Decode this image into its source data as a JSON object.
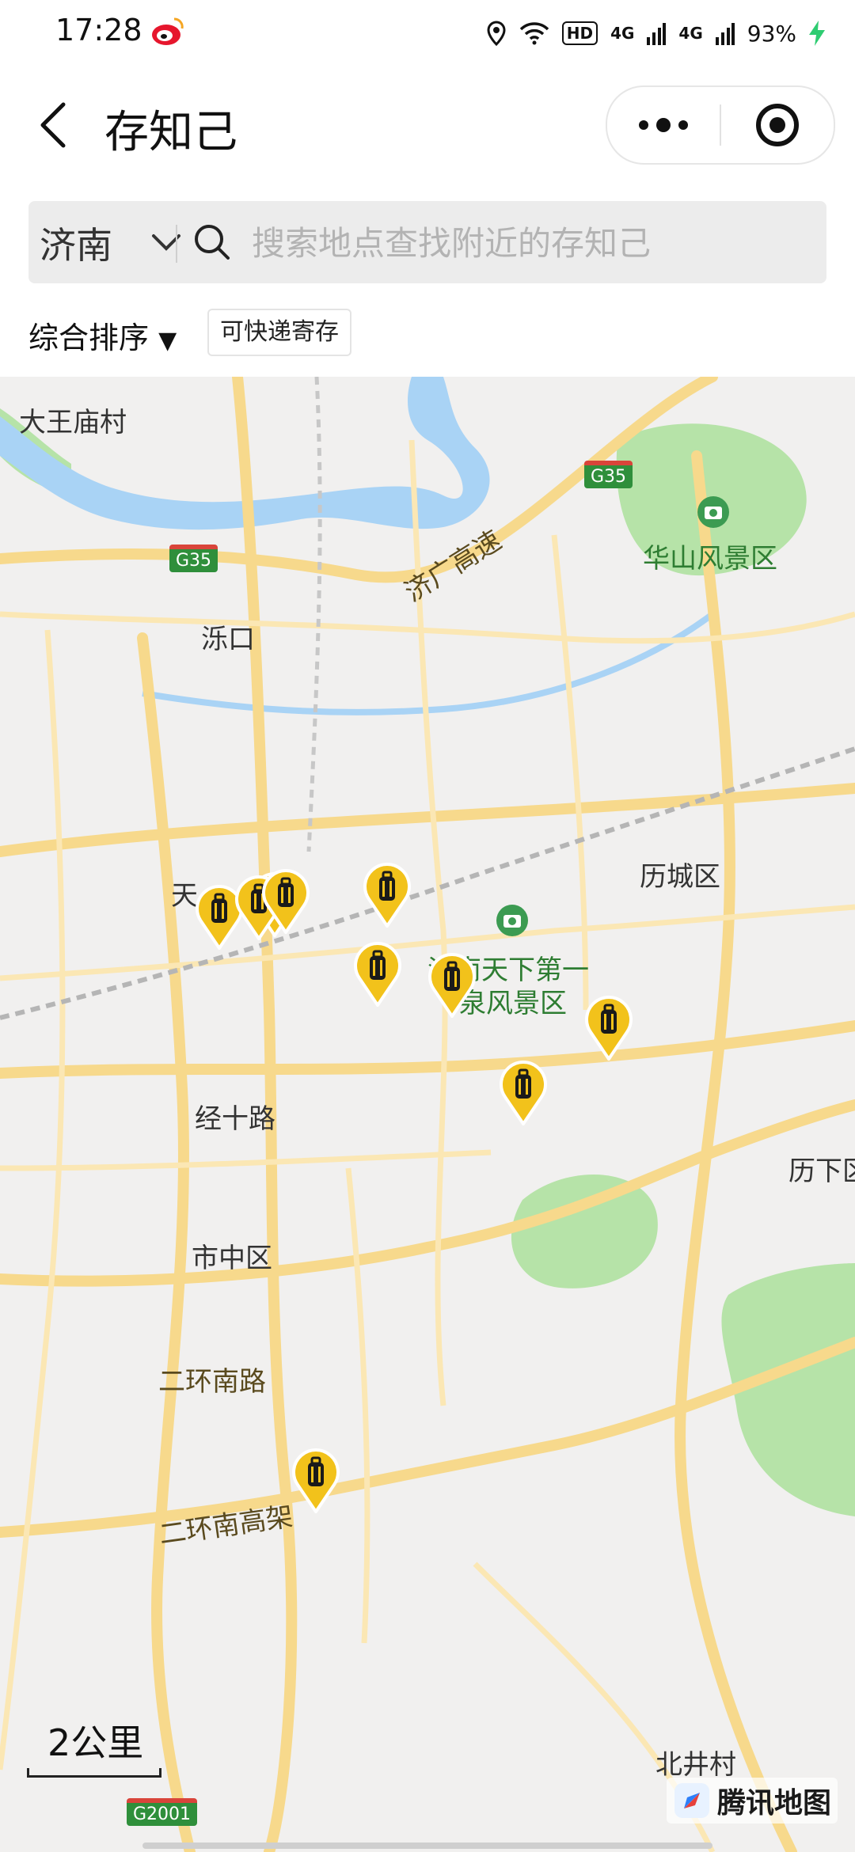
{
  "status_bar": {
    "time": "17:28",
    "hd": "HD",
    "net1": "4G",
    "net2": "4G",
    "battery": "93%"
  },
  "header": {
    "title": "存知己",
    "back_icon": "chevron-left-icon",
    "more_icon": "more-dots-icon",
    "close_icon": "target-circle-icon"
  },
  "search": {
    "city": "济南",
    "placeholder": "搜索地点查找附近的存知己"
  },
  "filters": {
    "sort_label": "综合排序",
    "sort_arrow": "▼",
    "express_label": "可快递寄存"
  },
  "map": {
    "labels": {
      "dawangmiao": "大王庙村",
      "luokou": "泺口",
      "huashan": "华山风景区",
      "jiguang": "济广高速",
      "licheng": "历城区",
      "tian": "天",
      "quancheng1": "济南天下第一",
      "quancheng2": "泉风景区",
      "jingshi": "经十路",
      "lixia": "历下区",
      "shizhong": "市中区",
      "erhuan": "二环南路",
      "erhuan_gaojia": "二环南高架",
      "beijing": "北井村"
    },
    "shields": {
      "g35_left": "G35",
      "g35_right": "G35",
      "g2001": "G2001"
    },
    "scale": "2公里",
    "provider": "腾讯地图",
    "pin_count": 10,
    "colors": {
      "pin": "#f2c21b",
      "road": "#f7d98c",
      "river": "#a9d3f5",
      "park": "#b6e3a8"
    }
  }
}
